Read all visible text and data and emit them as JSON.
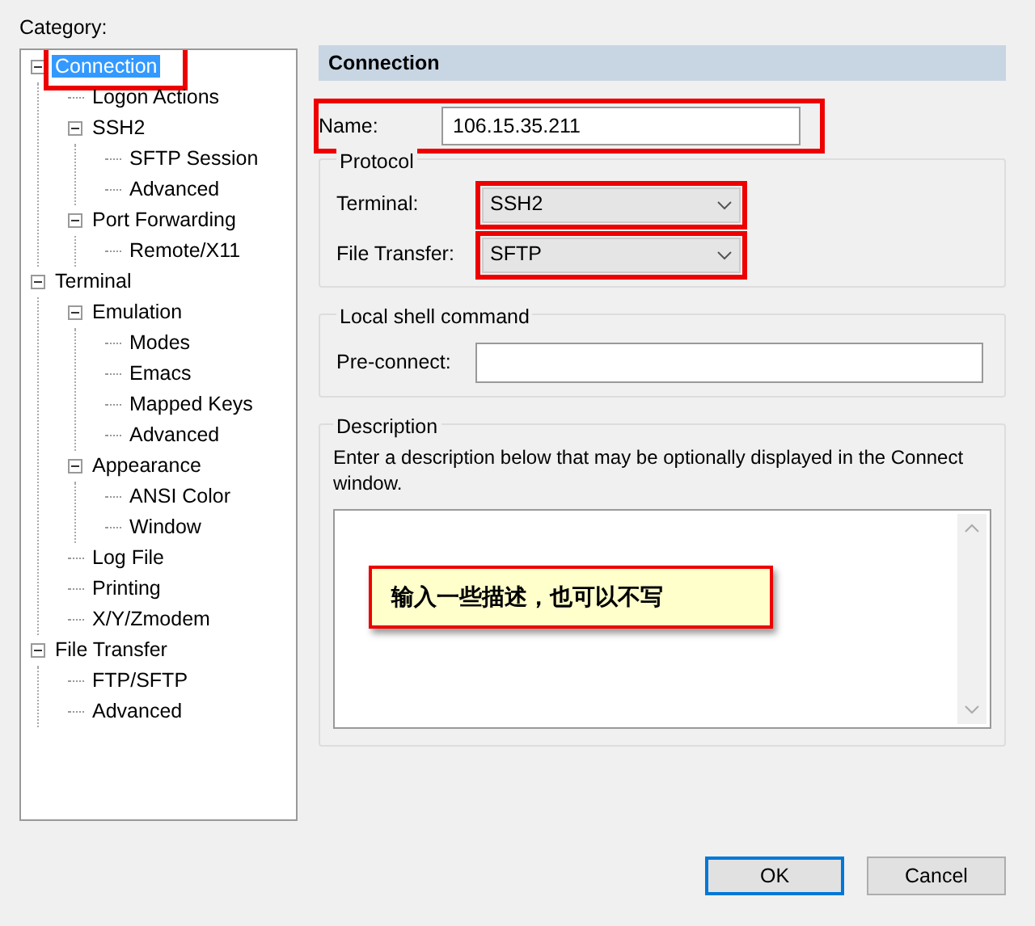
{
  "category_label": "Category:",
  "tree": [
    {
      "label": "Connection",
      "selected": true,
      "highlighted": true,
      "expanded": true,
      "children": [
        {
          "label": "Logon Actions",
          "selected": false
        },
        {
          "label": "SSH2",
          "selected": false,
          "expanded": true,
          "children": [
            {
              "label": "SFTP Session",
              "selected": false
            },
            {
              "label": "Advanced",
              "selected": false
            }
          ]
        },
        {
          "label": "Port Forwarding",
          "selected": false,
          "expanded": true,
          "children": [
            {
              "label": "Remote/X11",
              "selected": false
            }
          ]
        }
      ]
    },
    {
      "label": "Terminal",
      "selected": false,
      "expanded": true,
      "children": [
        {
          "label": "Emulation",
          "selected": false,
          "expanded": true,
          "children": [
            {
              "label": "Modes",
              "selected": false
            },
            {
              "label": "Emacs",
              "selected": false
            },
            {
              "label": "Mapped Keys",
              "selected": false
            },
            {
              "label": "Advanced",
              "selected": false
            }
          ]
        },
        {
          "label": "Appearance",
          "selected": false,
          "expanded": true,
          "children": [
            {
              "label": "ANSI Color",
              "selected": false
            },
            {
              "label": "Window",
              "selected": false
            }
          ]
        },
        {
          "label": "Log File",
          "selected": false
        },
        {
          "label": "Printing",
          "selected": false
        },
        {
          "label": "X/Y/Zmodem",
          "selected": false
        }
      ]
    },
    {
      "label": "File Transfer",
      "selected": false,
      "expanded": true,
      "children": [
        {
          "label": "FTP/SFTP",
          "selected": false
        },
        {
          "label": "Advanced",
          "selected": false
        }
      ]
    }
  ],
  "panel": {
    "title": "Connection",
    "name": {
      "label": "Name:",
      "value": "106.15.35.211",
      "highlighted": true
    },
    "protocol": {
      "title": "Protocol",
      "terminal": {
        "label": "Terminal:",
        "value": "SSH2",
        "highlighted": true
      },
      "file_transfer": {
        "label": "File Transfer:",
        "value": "SFTP",
        "highlighted": true
      }
    },
    "local_shell": {
      "title": "Local shell command",
      "pre_connect": {
        "label": "Pre-connect:"
      }
    },
    "description": {
      "title": "Description",
      "hint": "Enter a description below that may be optionally displayed in the Connect window.",
      "callout": "输入一些描述，也可以不写"
    }
  },
  "buttons": [
    {
      "label": "OK",
      "default": true
    },
    {
      "label": "Cancel",
      "default": false
    }
  ]
}
